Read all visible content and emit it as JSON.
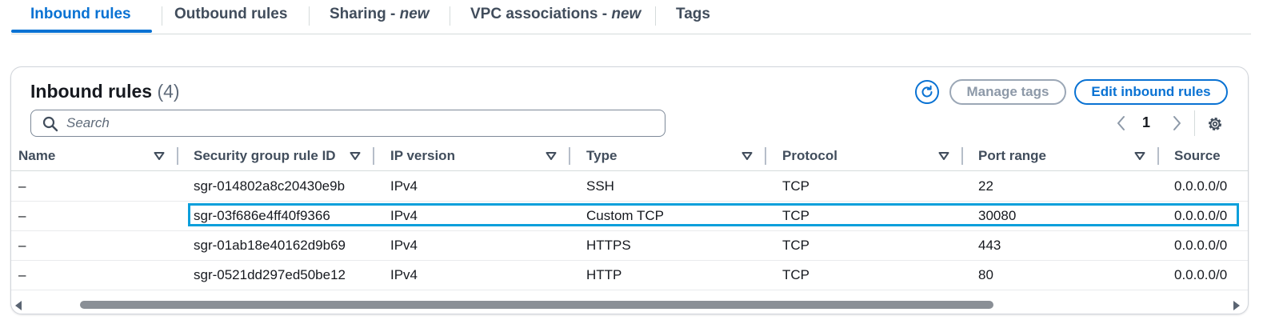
{
  "tabs": [
    {
      "label": "Inbound rules",
      "suffix": ""
    },
    {
      "label": "Outbound rules",
      "suffix": ""
    },
    {
      "label": "Sharing - ",
      "suffix": "new"
    },
    {
      "label": "VPC associations - ",
      "suffix": "new"
    },
    {
      "label": "Tags",
      "suffix": ""
    }
  ],
  "active_tab": "Inbound rules",
  "panel": {
    "title": "Inbound rules",
    "count": "(4)",
    "manage_tags_label": "Manage tags",
    "edit_rules_label": "Edit inbound rules",
    "search_placeholder": "Search",
    "page_number": "1"
  },
  "table": {
    "columns": [
      "Name",
      "Security group rule ID",
      "IP version",
      "Type",
      "Protocol",
      "Port range",
      "Source"
    ],
    "rows": [
      [
        "–",
        "sgr-014802a8c20430e9b",
        "IPv4",
        "SSH",
        "TCP",
        "22",
        "0.0.0.0/0"
      ],
      [
        "–",
        "sgr-03f686e4ff40f9366",
        "IPv4",
        "Custom TCP",
        "TCP",
        "30080",
        "0.0.0.0/0"
      ],
      [
        "–",
        "sgr-01ab18e40162d9b69",
        "IPv4",
        "HTTPS",
        "TCP",
        "443",
        "0.0.0.0/0"
      ],
      [
        "–",
        "sgr-0521dd297ed50be12",
        "IPv4",
        "HTTP",
        "TCP",
        "80",
        "0.0.0.0/0"
      ]
    ],
    "highlighted_row": 1
  },
  "colors": {
    "accent": "#0972d3",
    "highlight": "#0a9fdb"
  },
  "icons": [
    "refresh-icon",
    "search-icon",
    "chevron-left-icon",
    "chevron-right-icon",
    "gear-icon",
    "sort-down-icon"
  ]
}
